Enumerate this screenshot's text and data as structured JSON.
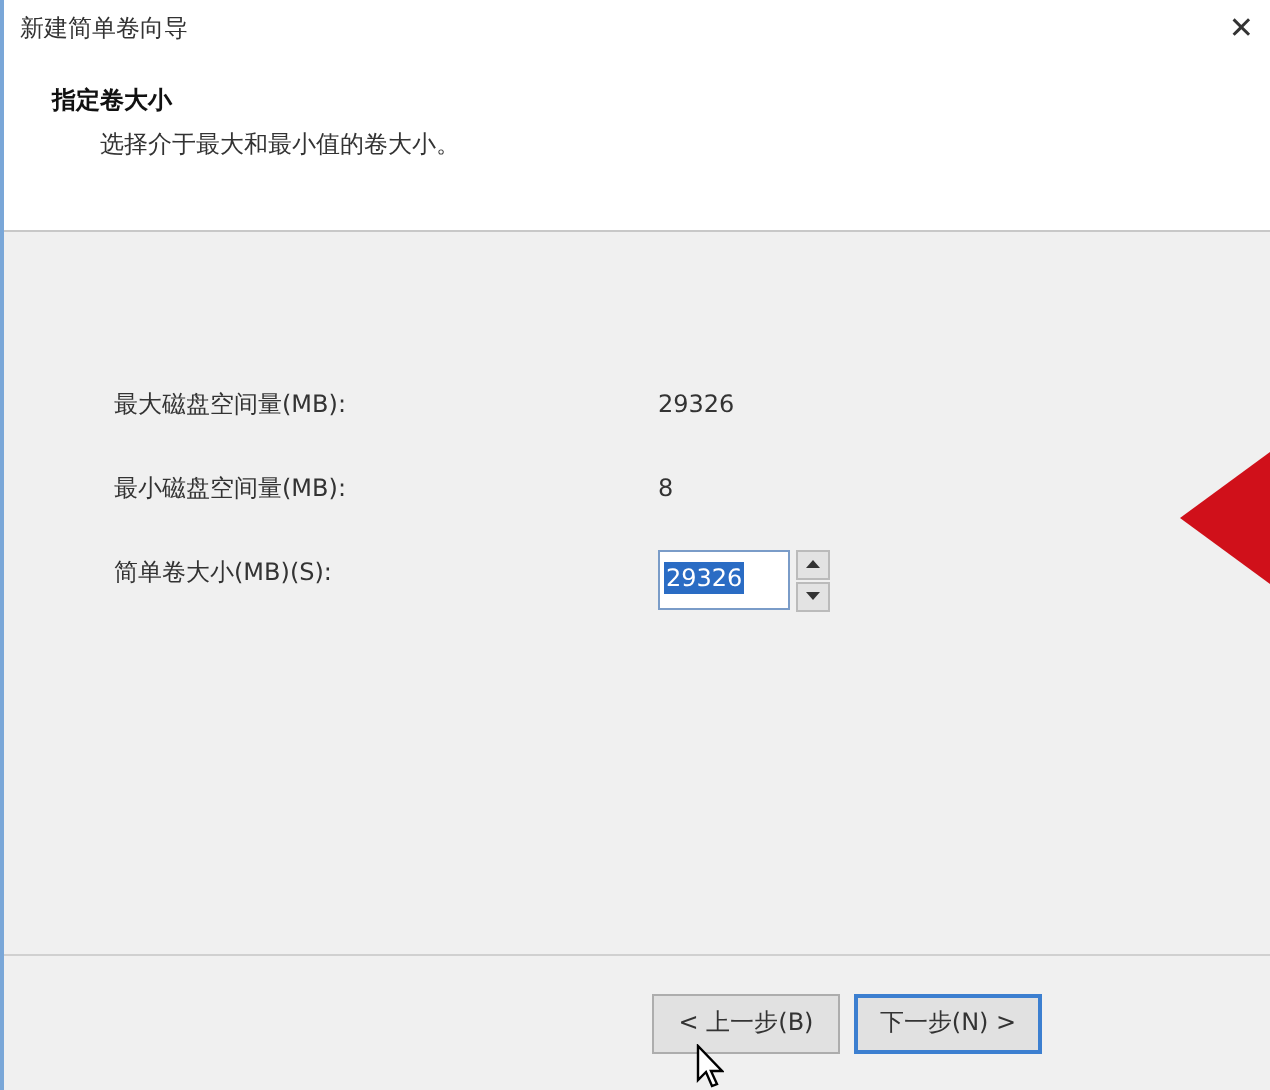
{
  "window": {
    "title": "新建简单卷向导",
    "close": "✕"
  },
  "header": {
    "title": "指定卷大小",
    "subtitle": "选择介于最大和最小值的卷大小。"
  },
  "fields": [
    {
      "kind": "info",
      "label": "最大磁盘空间量(MB):",
      "value": "29326"
    },
    {
      "kind": "info",
      "label": "最小磁盘空间量(MB):",
      "value": "8"
    },
    {
      "kind": "spin",
      "label": "简单卷大小(MB)(S):",
      "value": "29326",
      "selected": true
    }
  ],
  "buttons": [
    {
      "label": "< 上一步(B)",
      "selected": false
    },
    {
      "label": "下一步(N) >",
      "selected": true
    }
  ]
}
